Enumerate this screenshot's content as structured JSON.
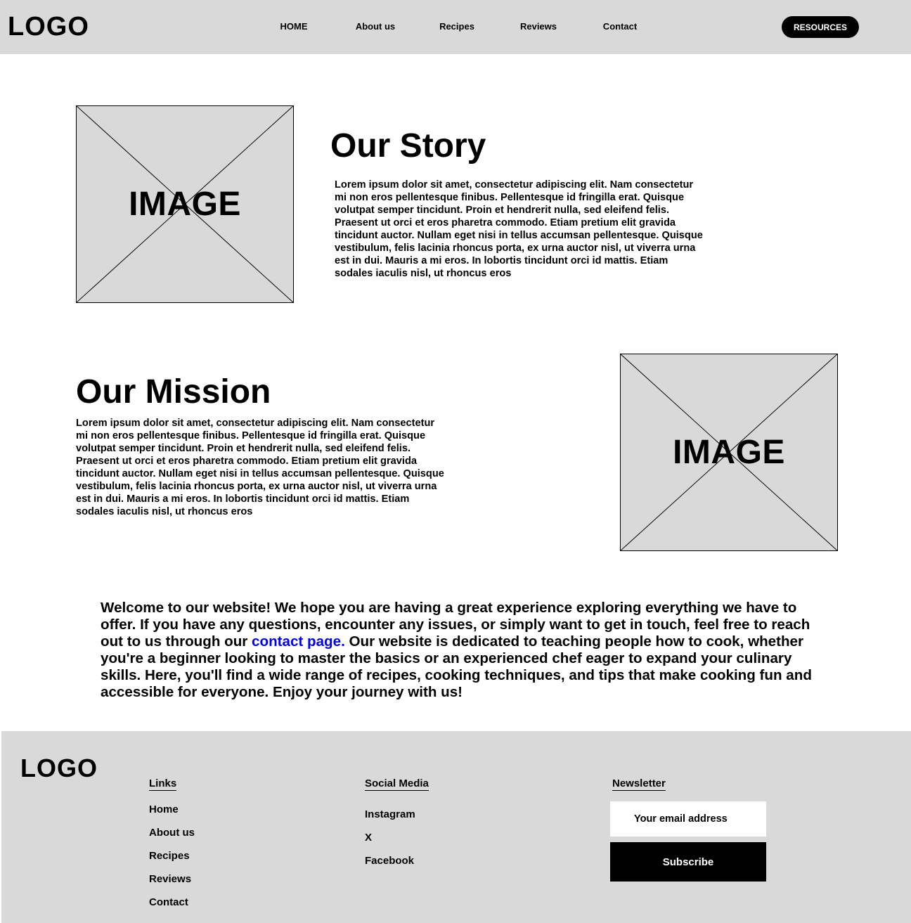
{
  "header": {
    "logo": "LOGO",
    "nav": [
      "HOME",
      "About us",
      "Recipes",
      "Reviews",
      "Contact"
    ],
    "resources_label": "RESOURCES"
  },
  "placeholder_label": "IMAGE",
  "story": {
    "title": "Our Story",
    "body": "Lorem ipsum dolor sit amet, consectetur adipiscing elit. Nam consectetur mi non eros pellentesque finibus. Pellentesque id fringilla erat. Quisque volutpat semper tincidunt. Proin et hendrerit nulla, sed eleifend felis. Praesent ut orci et eros pharetra commodo. Etiam pretium elit gravida tincidunt auctor. Nullam eget nisi in tellus accumsan pellentesque. Quisque vestibulum, felis lacinia rhoncus porta, ex urna auctor nisl, ut viverra urna est in dui. Mauris a mi eros. In lobortis tincidunt orci id mattis. Etiam sodales iaculis nisl, ut rhoncus eros"
  },
  "mission": {
    "title": "Our Mission",
    "body": "Lorem ipsum dolor sit amet, consectetur adipiscing elit. Nam consectetur mi non eros pellentesque finibus. Pellentesque id fringilla erat. Quisque volutpat semper tincidunt. Proin et hendrerit nulla, sed eleifend felis. Praesent ut orci et eros pharetra commodo. Etiam pretium elit gravida tincidunt auctor. Nullam eget nisi in tellus accumsan pellentesque. Quisque vestibulum, felis lacinia rhoncus porta, ex urna auctor nisl, ut viverra urna est in dui. Mauris a mi eros. In lobortis tincidunt orci id mattis. Etiam sodales iaculis nisl, ut rhoncus eros"
  },
  "welcome": {
    "before_link": "Welcome to our website! We hope you are having a great experience exploring everything we have to offer. If you have any questions, encounter any issues, or simply want to get in touch, feel free to reach out to us through our ",
    "link_text": "contact page.",
    "after_link": " Our website is dedicated to teaching people how to cook, whether you're a beginner looking to master the basics or an experienced chef eager to expand your culinary skills. Here, you'll find a wide range of recipes, cooking techniques, and tips that make cooking fun and accessible for everyone. Enjoy your journey with us!",
    "link_color": "#0000ee"
  },
  "footer": {
    "logo": "LOGO",
    "links_heading": "Links",
    "links": [
      "Home",
      "About us",
      "Recipes",
      "Reviews",
      "Contact"
    ],
    "social_heading": "Social Media",
    "social": [
      "Instagram",
      "X",
      "Facebook"
    ],
    "newsletter_heading": "Newsletter",
    "email_placeholder": "Your email address",
    "subscribe_label": "Subscribe"
  }
}
